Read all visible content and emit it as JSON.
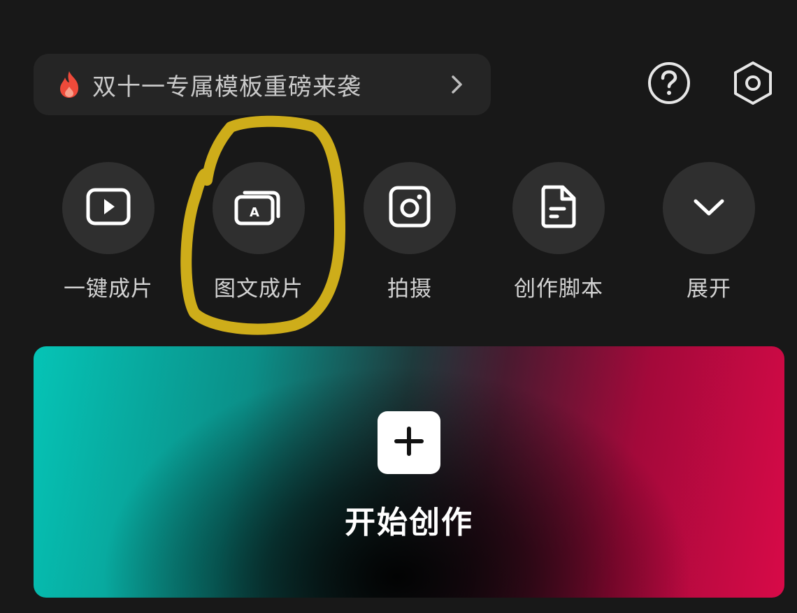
{
  "promo": {
    "text": "双十一专属模板重磅来袭",
    "icon": "fire-icon",
    "chevron_icon": "chevron-right-icon"
  },
  "top_icons": {
    "help": "help-circle-icon",
    "settings": "hexagon-settings-icon"
  },
  "actions": [
    {
      "label": "一键成片",
      "icon": "play-box-icon"
    },
    {
      "label": "图文成片",
      "icon": "text-image-stack-icon"
    },
    {
      "label": "拍摄",
      "icon": "camera-icon"
    },
    {
      "label": "创作脚本",
      "icon": "document-script-icon"
    },
    {
      "label": "展开",
      "icon": "chevron-down-icon"
    }
  ],
  "create": {
    "label": "开始创作",
    "icon": "plus-icon"
  },
  "colors": {
    "background": "#181818",
    "annotation": "#d8b51a",
    "fire": "#ef4a3a"
  }
}
